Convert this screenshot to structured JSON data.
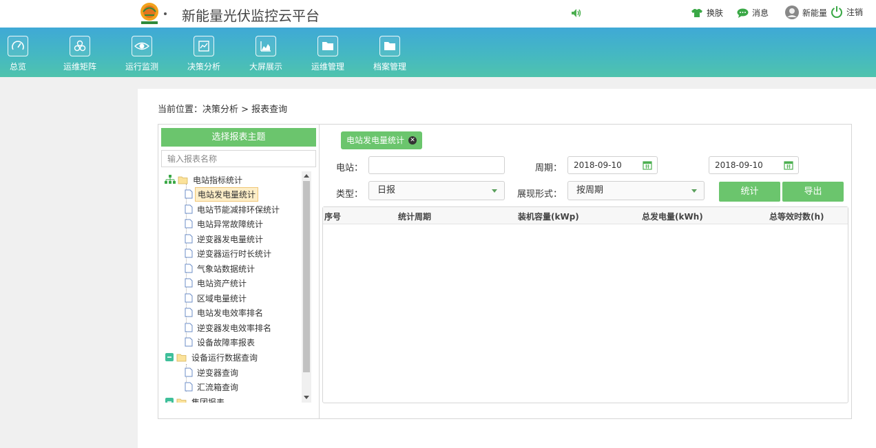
{
  "header": {
    "app_title": "新能量光伏监控云平台",
    "skin_label": "换肤",
    "message_label": "消息",
    "user_name": "新能量",
    "logout_label": "注销"
  },
  "nav": {
    "items": [
      {
        "label": "总览",
        "icon": "gauge-icon"
      },
      {
        "label": "运维矩阵",
        "icon": "cluster-icon"
      },
      {
        "label": "运行监测",
        "icon": "eye-icon"
      },
      {
        "label": "决策分析",
        "icon": "analysis-icon"
      },
      {
        "label": "大屏展示",
        "icon": "area-chart-icon"
      },
      {
        "label": "运维管理",
        "icon": "folder-icon"
      },
      {
        "label": "档案管理",
        "icon": "folder-icon"
      }
    ]
  },
  "breadcrumb": "当前位置：决策分析 > 报表查询",
  "left": {
    "title": "选择报表主题",
    "search_placeholder": "输入报表名称",
    "tree": {
      "group1": "电站指标统计",
      "group1_items": [
        "电站发电量统计",
        "电站节能减排环保统计",
        "电站异常故障统计",
        "逆变器发电量统计",
        "逆变器运行时长统计",
        "气象站数据统计",
        "电站资产统计",
        "区域电量统计",
        "电站发电效率排名",
        "逆变器发电效率排名",
        "设备故障率报表"
      ],
      "group2": "设备运行数据查询",
      "group2_items": [
        "逆变器查询",
        "汇流箱查询"
      ],
      "group3": "集团报表"
    }
  },
  "right": {
    "tab_label": "电站发电量统计",
    "station_label": "电站：",
    "station_value": "",
    "period_label": "周期：",
    "date_start": "2018-09-10",
    "date_end": "2018-09-10",
    "type_label": "类型：",
    "type_value": "日报",
    "display_label": "展现形式：",
    "display_value": "按周期",
    "stat_button": "统计",
    "export_button": "导出",
    "columns": [
      "序号",
      "统计周期",
      "装机容量(kWp)",
      "总发电量(kWh)",
      "总等效时数(h)"
    ]
  },
  "colors": {
    "green": "#6bc56d",
    "nav_top": "#3fa9d6",
    "nav_bottom": "#4fc3ad"
  }
}
